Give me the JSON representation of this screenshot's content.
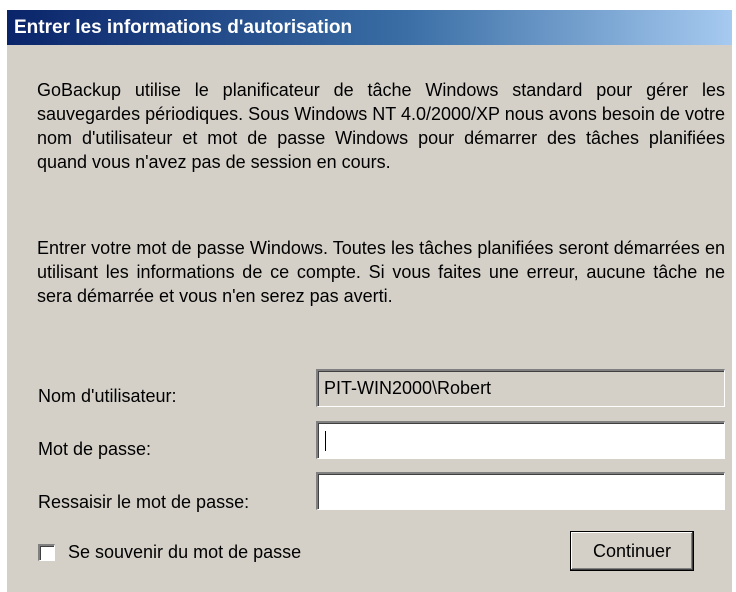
{
  "dialog": {
    "title": "Entrer les informations d'autorisation",
    "paragraph1": "GoBackup utilise le planificateur de tâche Windows standard pour gérer les sauvegardes périodiques. Sous Windows NT 4.0/2000/XP nous avons besoin de votre nom d'utilisateur et mot de passe Windows pour démarrer des tâches planifiées quand vous n'avez pas de session en cours.",
    "paragraph2": "Entrer votre mot de passe Windows. Toutes les tâches planifiées seront démarrées en utilisant les informations de ce compte. Si vous faites une erreur, aucune tâche ne sera démarrée et vous n'en serez pas averti."
  },
  "form": {
    "username_label": "Nom d'utilisateur:",
    "username_value": "PIT-WIN2000\\Robert",
    "password_label": "Mot de passe:",
    "password_value": "",
    "repassword_label": "Ressaisir le mot de passe:",
    "repassword_value": "",
    "remember_label": "Se souvenir du mot de passe",
    "remember_checked": false,
    "continue_label": "Continuer"
  }
}
